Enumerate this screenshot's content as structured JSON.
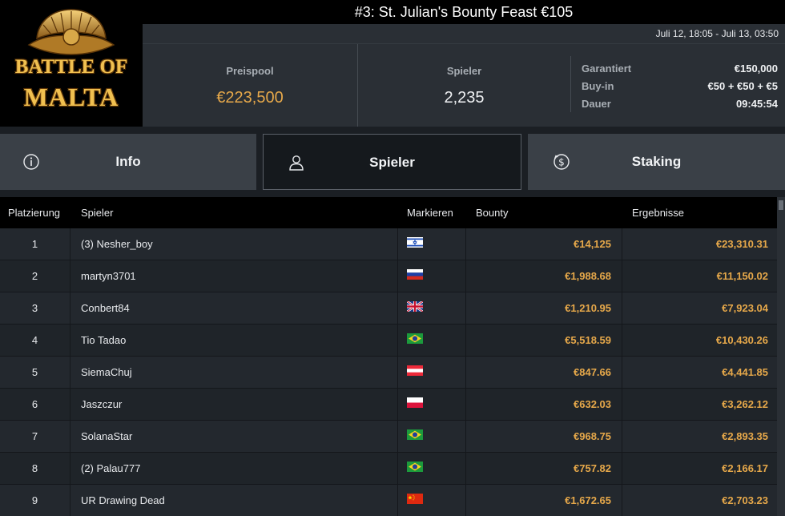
{
  "logo": {
    "line1": "BATTLE OF",
    "line2": "MALTA"
  },
  "tournament": {
    "title": "#3: St. Julian's Bounty Feast €105",
    "dates": "Juli 12, 18:05 - Juli 13, 03:50"
  },
  "stats": {
    "pool_label": "Preispool",
    "pool_value": "€223,500",
    "players_label": "Spieler",
    "players_value": "2,235",
    "details": [
      {
        "label": "Garantiert",
        "value": "€150,000"
      },
      {
        "label": "Buy-in",
        "value": "€50 + €50 + €5"
      },
      {
        "label": "Dauer",
        "value": "09:45:54"
      }
    ]
  },
  "tabs": [
    {
      "label": "Info",
      "icon": "info-icon"
    },
    {
      "label": "Spieler",
      "icon": "user-icon"
    },
    {
      "label": "Staking",
      "icon": "dollar-icon"
    }
  ],
  "table": {
    "headers": [
      "Platzierung",
      "Spieler",
      "Markieren",
      "Bounty",
      "Ergebnisse"
    ],
    "rows": [
      {
        "place": "1",
        "name": "(3) Nesher_boy",
        "flag": "israel",
        "bounty": "€14,125",
        "result": "€23,310.31"
      },
      {
        "place": "2",
        "name": "martyn3701",
        "flag": "russia",
        "bounty": "€1,988.68",
        "result": "€11,150.02"
      },
      {
        "place": "3",
        "name": "Conbert84",
        "flag": "uk",
        "bounty": "€1,210.95",
        "result": "€7,923.04"
      },
      {
        "place": "4",
        "name": "Tio Tadao",
        "flag": "brazil",
        "bounty": "€5,518.59",
        "result": "€10,430.26"
      },
      {
        "place": "5",
        "name": "SiemaChuj",
        "flag": "austria",
        "bounty": "€847.66",
        "result": "€4,441.85"
      },
      {
        "place": "6",
        "name": "Jaszczur",
        "flag": "poland",
        "bounty": "€632.03",
        "result": "€3,262.12"
      },
      {
        "place": "7",
        "name": "SolanaStar",
        "flag": "brazil",
        "bounty": "€968.75",
        "result": "€2,893.35"
      },
      {
        "place": "8",
        "name": "(2) Palau777",
        "flag": "brazil",
        "bounty": "€757.82",
        "result": "€2,166.17"
      },
      {
        "place": "9",
        "name": "UR Drawing Dead",
        "flag": "china",
        "bounty": "€1,672.65",
        "result": "€2,703.23"
      }
    ]
  },
  "colors": {
    "accent": "#e6a84a",
    "background": "#1b1f24",
    "panel": "#2a2f35"
  }
}
